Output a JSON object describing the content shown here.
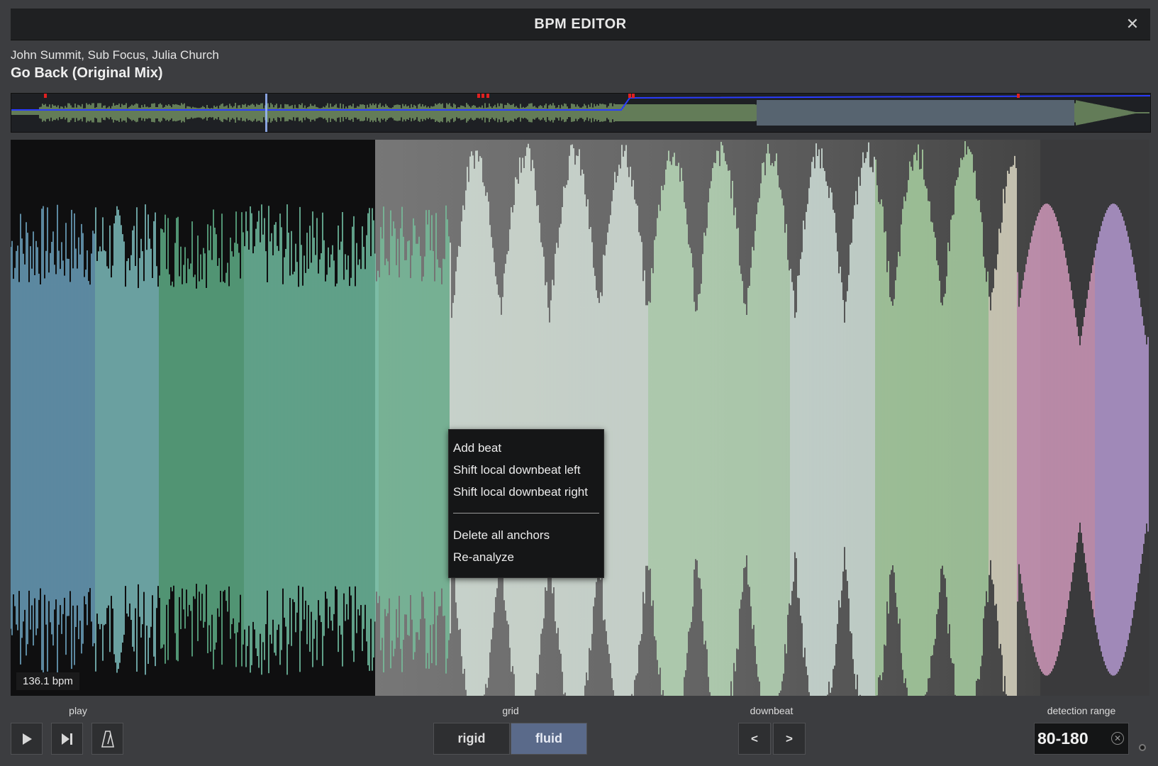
{
  "window": {
    "title": "BPM EDITOR",
    "close_icon": "close-icon"
  },
  "track": {
    "artist": "John Summit, Sub Focus, Julia Church",
    "title": "Go Back (Original Mix)"
  },
  "waveform": {
    "bpm_label": "136.1 bpm"
  },
  "context_menu": {
    "items": [
      "Add beat",
      "Shift local downbeat left",
      "Shift local downbeat right"
    ],
    "items2": [
      "Delete all anchors",
      "Re-analyze"
    ]
  },
  "controls": {
    "play_label": "play",
    "grid_label": "grid",
    "downbeat_label": "downbeat",
    "detection_label": "detection range",
    "rigid": "rigid",
    "fluid": "fluid",
    "left_arrow": "<",
    "right_arrow": ">",
    "range_value": "80-180",
    "active_grid": "fluid"
  },
  "colors": {
    "accent": "#5a6a8a",
    "background": "#3c3d40",
    "beat_marker": "#e02020",
    "tempo_line": "#2a3cff"
  }
}
